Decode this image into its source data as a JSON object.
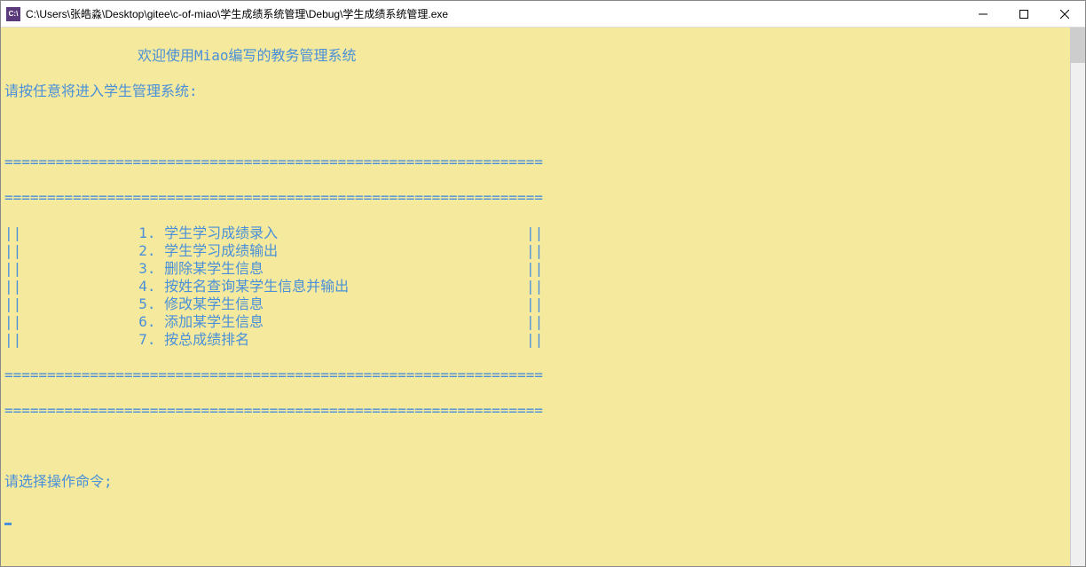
{
  "window": {
    "title": "C:\\Users\\张皓淼\\Desktop\\gitee\\c-of-miao\\学生成绩系统管理\\Debug\\学生成绩系统管理.exe",
    "icon_label": "C:\\"
  },
  "console": {
    "welcome": "欢迎使用Miao编写的教务管理系统",
    "prompt_enter": "请按任意将进入学生管理系统:",
    "separator": "===============================================================",
    "menu_items": [
      "1. 学生学习成绩录入",
      "2. 学生学习成绩输出",
      "3. 删除某学生信息",
      "4. 按姓名查询某学生信息并输出",
      "5. 修改某学生信息",
      "6. 添加某学生信息",
      "7. 按总成绩排名"
    ],
    "menu_left_bar": "||",
    "menu_right_bar": "||",
    "menu_right_pos_chars": 60,
    "prompt_select": "请选择操作命令;"
  }
}
